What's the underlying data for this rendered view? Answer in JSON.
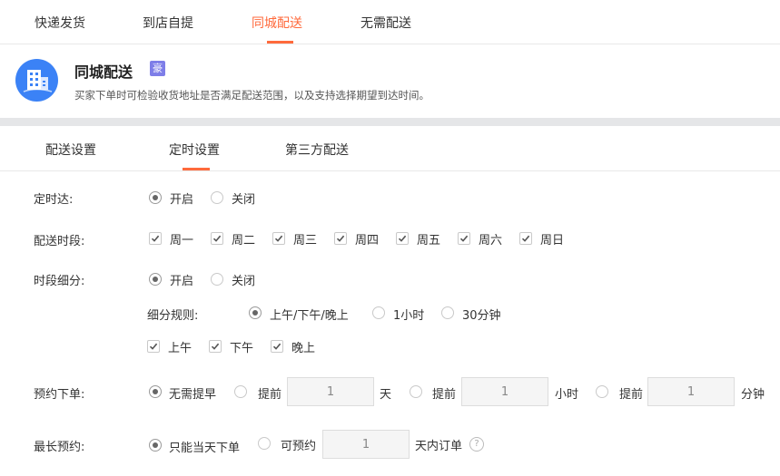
{
  "top_tabs": [
    "快递发货",
    "到店自提",
    "同城配送",
    "无需配送"
  ],
  "active_top_tab": "同城配送",
  "header": {
    "title": "同城配送",
    "badge": "豪",
    "description": "买家下单时可检验收货地址是否满足配送范围，以及支持选择期望到达时间。"
  },
  "sub_tabs": [
    "配送设置",
    "定时设置",
    "第三方配送"
  ],
  "active_sub_tab": "定时设置",
  "form": {
    "timed_delivery": {
      "label": "定时达:",
      "on": "开启",
      "off": "关闭"
    },
    "delivery_days": {
      "label": "配送时段:",
      "days": [
        "周一",
        "周二",
        "周三",
        "周四",
        "周五",
        "周六",
        "周日"
      ]
    },
    "slot_split": {
      "label": "时段细分:",
      "on": "开启",
      "off": "关闭",
      "rule_label": "细分规则:",
      "rules": [
        "上午/下午/晚上",
        "1小时",
        "30分钟"
      ],
      "periods": [
        "上午",
        "下午",
        "晚上"
      ]
    },
    "advance_order": {
      "label": "预约下单:",
      "no_advance": "无需提早",
      "advance": "提前",
      "day_value": "1",
      "day_unit": "天",
      "hour_value": "1",
      "hour_unit": "小时",
      "minute_value": "1",
      "minute_unit": "分钟"
    },
    "max_advance": {
      "label": "最长预约:",
      "same_day": "只能当天下单",
      "bookable": "可预约",
      "value": "1",
      "unit": "天内订单",
      "help": "?"
    }
  },
  "colors": {
    "accent": "#ff6a3c",
    "logo_blue": "#3b82f6",
    "badge_purple": "#7e7ee8"
  }
}
